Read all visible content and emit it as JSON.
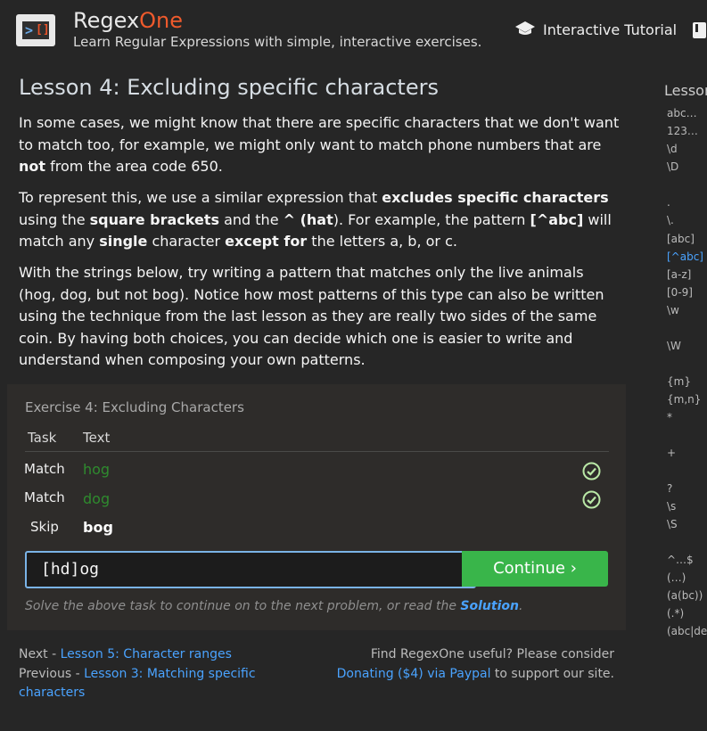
{
  "header": {
    "logo_glyph": ">",
    "logo_brackets": "[]",
    "brand_main": "Regex",
    "brand_accent": "One",
    "tagline": "Learn Regular Expressions with simple, interactive exercises.",
    "nav_tutorial": "Interactive Tutorial"
  },
  "lesson": {
    "title": "Lesson 4: Excluding specific characters",
    "p1": [
      "In some cases, we might know that there are specific characters that we don't want to match too, for example, we might only want to match phone numbers that are ",
      "not",
      " from the area code 650."
    ],
    "p2": [
      "To represent this, we use a similar expression that ",
      "excludes specific characters",
      " using the ",
      "square brackets",
      " and the ",
      "^ (hat",
      "). For example, the pattern ",
      "[^abc]",
      " will match any ",
      "single",
      " character ",
      "except for",
      " the letters a, b, or c."
    ],
    "p3": "With the strings below, try writing a pattern that matches only the live animals (hog, dog, but not bog). Notice how most patterns of this type can also be written using the technique from the last lesson as they are really two sides of the same coin. By having both choices, you can decide which one is easier to write and understand when composing your own patterns."
  },
  "sidebar": {
    "title": "Lesson",
    "items": [
      "abc…",
      "123…",
      "\\d",
      "\\D",
      ".",
      "\\.",
      "[abc]",
      "[^abc]",
      "[a-z]",
      "[0-9]",
      "\\w",
      "\\W",
      "{m}",
      "{m,n}",
      "*",
      "+",
      "?",
      "\\s",
      "\\S",
      "^…$",
      "(…)",
      "(a(bc))",
      "(.*)",
      "(abc|def)"
    ],
    "active_index": 7
  },
  "exercise": {
    "title": "Exercise 4: Excluding Characters",
    "col_task": "Task",
    "col_text": "Text",
    "rows": [
      {
        "task": "Match",
        "text": "hog",
        "status": "done"
      },
      {
        "task": "Match",
        "text": "dog",
        "status": "done"
      },
      {
        "task": "Skip",
        "text": "bog",
        "status": "none"
      }
    ],
    "input_value": "[hd]og",
    "continue_label": "Continue ›",
    "hint_text": "Solve the above task to continue on to the next problem, or read the ",
    "hint_link": "Solution",
    "hint_end": "."
  },
  "footer": {
    "next_prefix": "Next - ",
    "next_link": "Lesson 5: Character ranges",
    "prev_prefix": "Previous - ",
    "prev_link": "Lesson 3: Matching specific characters",
    "donate_prefix": "Find RegexOne useful? Please consider",
    "donate_link": "Donating ($4) via Paypal",
    "donate_suffix": " to support our site."
  },
  "colors": {
    "background": "#262626",
    "panel": "#2e2c2a",
    "accent_orange": "#ef5a2c",
    "link_blue": "#4aa3ff",
    "match_green": "#2e8b2e",
    "continue_green": "#39b54a"
  }
}
